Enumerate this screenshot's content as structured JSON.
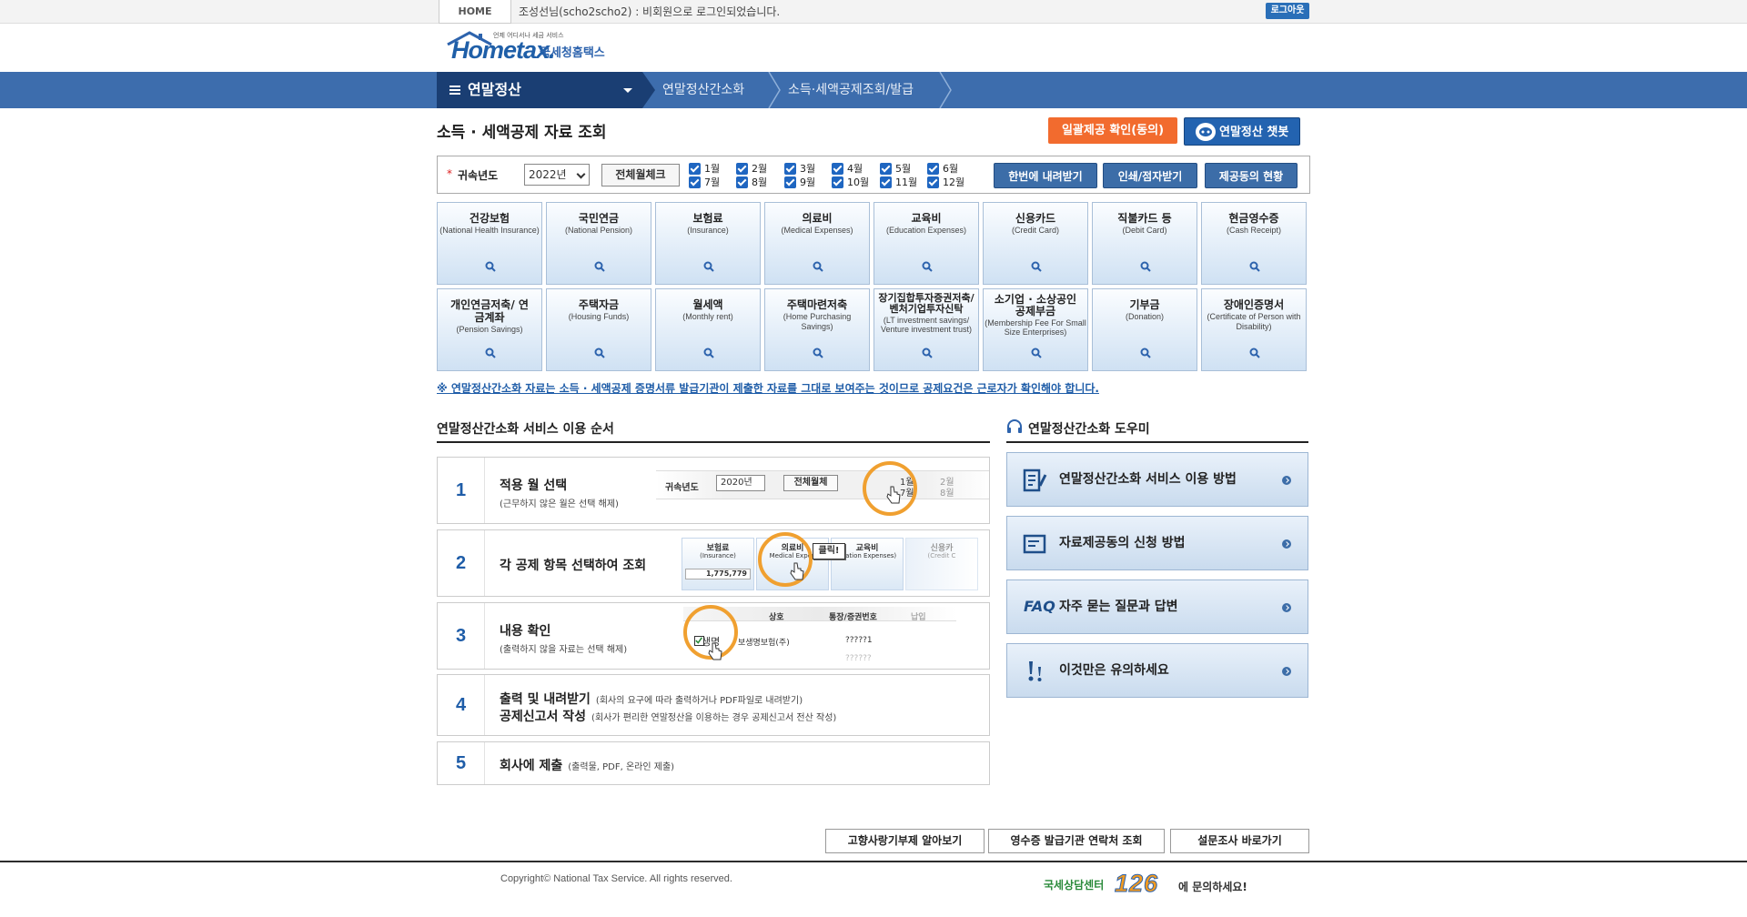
{
  "topbar": {
    "home": "HOME",
    "message": "조성선님(scho2scho2) : 비회원으로 로그인되었습니다.",
    "logout": "로그아웃"
  },
  "logo": {
    "brand": "Hometax.",
    "korean": "국세청홈택스",
    "small": "언제 어디서나 세금 서비스"
  },
  "nav": {
    "menu_label": "연말정산",
    "breadcrumb": [
      "연말정산간소화",
      "소득·세액공제조회/발급"
    ]
  },
  "page": {
    "title": "소득 · 세액공제 자료 조회",
    "consent_button": "일괄제공 확인(동의)",
    "chatbot_button": "연말정산 챗봇"
  },
  "filter": {
    "required_mark": "*",
    "year_label": "귀속년도",
    "year_value": "2022년",
    "select_all": "전체월체크",
    "months": [
      "1월",
      "2월",
      "3월",
      "4월",
      "5월",
      "6월",
      "7월",
      "8월",
      "9월",
      "10월",
      "11월",
      "12월"
    ],
    "download_all": "한번에 내려받기",
    "print": "인쇄/점자받기",
    "consent_status": "제공동의 현황"
  },
  "categories": [
    {
      "ko": "건강보험",
      "en": "(National Health Insurance)"
    },
    {
      "ko": "국민연금",
      "en": "(National Pension)"
    },
    {
      "ko": "보험료",
      "en": "(Insurance)"
    },
    {
      "ko": "의료비",
      "en": "(Medical Expenses)"
    },
    {
      "ko": "교육비",
      "en": "(Education Expenses)"
    },
    {
      "ko": "신용카드",
      "en": "(Credit Card)"
    },
    {
      "ko": "직불카드 등",
      "en": "(Debit Card)"
    },
    {
      "ko": "현금영수증",
      "en": "(Cash Receipt)"
    },
    {
      "ko": "개인연금저축/ 연금계좌",
      "en": "(Pension Savings)"
    },
    {
      "ko": "주택자금",
      "en": "(Housing Funds)"
    },
    {
      "ko": "월세액",
      "en": "(Monthly rent)"
    },
    {
      "ko": "주택마련저축",
      "en": "(Home Purchasing Savings)"
    },
    {
      "ko": "장기집합투자증권저축/ 벤처기업투자신탁",
      "en": "(LT investment savings/ Venture investment trust)"
    },
    {
      "ko": "소기업 · 소상공인 공제부금",
      "en": "(Membership Fee For Small Size Enterprises)"
    },
    {
      "ko": "기부금",
      "en": "(Donation)"
    },
    {
      "ko": "장애인증명서",
      "en": "(Certificate of Person with Disability)"
    }
  ],
  "notice": "※ 연말정산간소화 자료는 소득 · 세액공제 증명서류 발급기관이 제출한 자료를 그대로 보여주는 것이므로 공제요건은 근로자가 확인해야 합니다.",
  "steps": {
    "title": "연말정산간소화 서비스 이용 순서",
    "items": [
      {
        "num": "1",
        "title": "적용 월 선택",
        "sub": "(근무하지 않은 월은 선택 해제)"
      },
      {
        "num": "2",
        "title": "각 공제 항목 선택하여 조회",
        "sub": ""
      },
      {
        "num": "3",
        "title": "내용 확인",
        "sub": "(출력하지 않을 자료는 선택 해제)"
      },
      {
        "num": "4",
        "title": "출력 및 내려받기",
        "title_note": "(회사의 요구에 따라 출력하거나 PDF파일로 내려받기)",
        "title2": "공제신고서 작성",
        "title2_note": "(회사가 편리한 연말정산을 이용하는 경우 공제신고서 전산 작성)"
      },
      {
        "num": "5",
        "title": "회사에 제출",
        "title_note": "(출력물, PDF, 온라인 제출)"
      }
    ],
    "illus1": {
      "label": "귀속년도",
      "year": "2020년",
      "btn": "전체월체",
      "m1": "1월",
      "m7": "7월",
      "m2": "2월",
      "m8": "8월"
    },
    "illus2": {
      "c1": "보험료",
      "c1en": "(Insurance)",
      "c1val": "1,775,779",
      "c2": "의료비",
      "c2en": "Medical Expen",
      "c3": "교육비",
      "c3en": "ucation Expenses)",
      "c4": "신용카",
      "c4en": "(Credit C",
      "click": "클릭!"
    },
    "illus3": {
      "h1": "상호",
      "h2": "통장/증권번호",
      "h3": "납입",
      "row": "생명",
      "row2": "보생명보험(주)",
      "val": "?????1",
      "val2": "??????"
    }
  },
  "helper": {
    "title": "연말정산간소화 도우미",
    "items": [
      {
        "label": "연말정산간소화 서비스 이용 방법",
        "icon": "guide-icon"
      },
      {
        "label": "자료제공동의 신청 방법",
        "icon": "document-icon"
      },
      {
        "label": "자주 묻는 질문과 답변",
        "icon": "faq-icon",
        "prefix": "FAQ"
      },
      {
        "label": "이것만은 유의하세요",
        "icon": "exclamation-icon"
      }
    ]
  },
  "bottom_buttons": [
    "고향사랑기부제 알아보기",
    "영수증 발급기관 연락처 조회",
    "설문조사 바로가기"
  ],
  "footer": {
    "copyright": "Copyright© National Tax Service. All rights reserved.",
    "callcenter_label": "국세상담센터",
    "callcenter_number": "126",
    "callcenter_suffix": "에 문의하세요!"
  },
  "colors": {
    "nav": "#3d6dad",
    "nav_dark": "#1a3e73",
    "accent_orange": "#f26b2e",
    "accent_blue": "#2363b0"
  }
}
